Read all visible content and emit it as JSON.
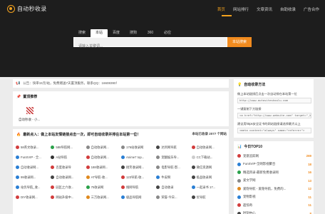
{
  "brand": {
    "logo_text": "自动秒收录",
    "accent": "#f3a21e"
  },
  "nav": [
    {
      "label": "首页",
      "active": true
    },
    {
      "label": "网站排行"
    },
    {
      "label": "文章资讯"
    },
    {
      "label": "自助收录"
    },
    {
      "label": "广告合作"
    }
  ],
  "search": {
    "tabs": [
      {
        "label": "搜索"
      },
      {
        "label": "本站",
        "active": true
      },
      {
        "label": "百度"
      },
      {
        "label": "搜狗"
      },
      {
        "label": "360"
      },
      {
        "label": "必应"
      }
    ],
    "placeholder": "请输入关键词...",
    "button": "本站搜索"
  },
  "notice": {
    "icon": "megaphone-icon",
    "text": "公告：快审15元/站，免费赠送7天置顶服务，联系QQ：16608390！"
  },
  "pinned": {
    "title": "置顶推荐",
    "icon": "pin-icon",
    "item_label": "自动秒收 - 小..."
  },
  "listing": {
    "title": "最新点入：做上本站友情链接点击一次，即可自动收录并排在本站第一位！",
    "count_label": "本站已收录 2077 个网站",
    "sites": [
      {
        "name": "58英文收录...",
        "color": "#d23c3c"
      },
      {
        "name": "588导航网...",
        "color": "#2aa14a"
      },
      {
        "name": "自动收录网...",
        "color": "#888888"
      },
      {
        "name": "176站收录网",
        "color": "#888888"
      },
      {
        "name": "达目网导航",
        "color": "#444444"
      },
      {
        "name": "自动收录网...",
        "color": "#d23c3c"
      },
      {
        "name": "FunSVIP - 全...",
        "color": "#2a7fd4"
      },
      {
        "name": "A站导航",
        "color": "#333333"
      },
      {
        "name": "自动收录网...",
        "color": "#d23c3c"
      },
      {
        "name": "Anime7 top...",
        "color": "#2a7fd4"
      },
      {
        "name": "宠翻娱乐导...",
        "color": "#888888"
      },
      {
        "name": "CC下载站...",
        "color": "#cccccc"
      },
      {
        "name": "自动收录网...",
        "color": "#2a7fd4"
      },
      {
        "name": "百度收录导",
        "color": "#d23c3c"
      },
      {
        "name": "188收录网...",
        "color": "#d23c3c"
      },
      {
        "name": "搞笑收录网...",
        "color": "#444444"
      },
      {
        "name": "电影导航-影...",
        "color": "#888888"
      },
      {
        "name": "微信资源网",
        "color": "#444444"
      },
      {
        "name": "99收录网...",
        "color": "#2a7fd4"
      },
      {
        "name": "自动收录网...",
        "color": "#444444"
      },
      {
        "name": "AT导航-收...",
        "color": "#e08a1e"
      },
      {
        "name": "123导航-收...",
        "color": "#d23c3c"
      },
      {
        "name": "牛皮啊",
        "color": "#2a7fd4"
      },
      {
        "name": "极品收录网",
        "color": "#444444"
      },
      {
        "name": "站优导航_收...",
        "color": "#2a7fd4"
      },
      {
        "name": "园区之六收...",
        "color": "#d23c3c"
      },
      {
        "name": "75收录网",
        "color": "#2aa14a"
      },
      {
        "name": "搜网导航",
        "color": "#d23c3c"
      },
      {
        "name": "自动收录",
        "color": "#444444"
      },
      {
        "name": "一起录书 17...",
        "color": "#2a7fd4"
      },
      {
        "name": "DIY收录网...",
        "color": "#d23c3c"
      },
      {
        "name": "网站升级中...",
        "color": "#d23c3c"
      },
      {
        "name": "三万收录网...",
        "color": "#e08a1e"
      },
      {
        "name": "极品导航网",
        "color": "#2a7fd4"
      },
      {
        "name": "荣誉-今日...",
        "color": "#888888"
      },
      {
        "name": "优导航",
        "color": "#444444"
      }
    ]
  },
  "method": {
    "title": "自动收录方法",
    "step1": "做上本站链接后点击一次自动排在本站第一位",
    "code1": "http://www.autositeshoulu.com",
    "step2": "一键复制下方链接",
    "code2": "<a href=\"http://www.website.com\" target=\"_bl...",
    "step3": "建议用https安全证书的网站链接请选择最大以上",
    "code3": "<meta content=\"always\" name=\"referrer\">"
  },
  "ranking": {
    "title": "今日TOP10",
    "items": [
      {
        "name": "宠意追踪网",
        "score": "269",
        "color": "#d23c3c"
      },
      {
        "name": "FunSVIP-全网影视聚合",
        "score": "18",
        "color": "#2a7fd4"
      },
      {
        "name": "精选目录-最新免费收录网",
        "score": "16",
        "color": "#2aa14a"
      },
      {
        "name": "爱文学网",
        "score": "13",
        "color": "#888888"
      },
      {
        "name": "爱隐导航 - 爱隐导航，免费的...",
        "score": "12",
        "color": "#e08a1e"
      },
      {
        "name": "宠物影视",
        "score": "11",
        "color": "#2a7fd4"
      },
      {
        "name": "超惊奇",
        "score": "11",
        "color": "#d23c3c"
      },
      {
        "name": "时刻中心",
        "score": "8",
        "color": "#444444"
      }
    ]
  }
}
